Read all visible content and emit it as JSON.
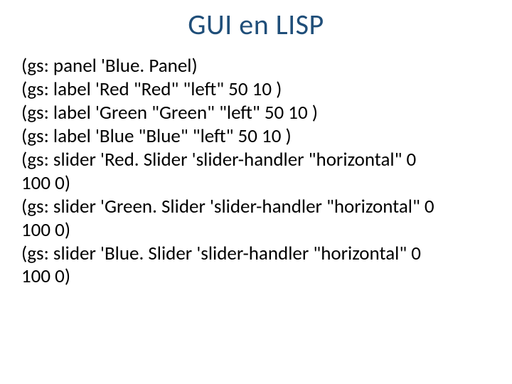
{
  "title": "GUI en LISP",
  "lines": [
    "(gs: panel 'Blue. Panel)",
    "(gs: label 'Red \"Red\" \"left\" 50 10 )",
    "(gs: label 'Green \"Green\" \"left\" 50 10 )",
    "(gs: label 'Blue \"Blue\" \"left\" 50 10 )",
    "(gs: slider  'Red. Slider  'slider-handler  \"horizontal\"  0",
    "100 0)",
    "(gs: slider 'Green. Slider 'slider-handler \"horizontal\" 0",
    "100 0)",
    "(gs: slider  'Blue. Slider  'slider-handler  \"horizontal\"  0",
    "100 0)"
  ]
}
